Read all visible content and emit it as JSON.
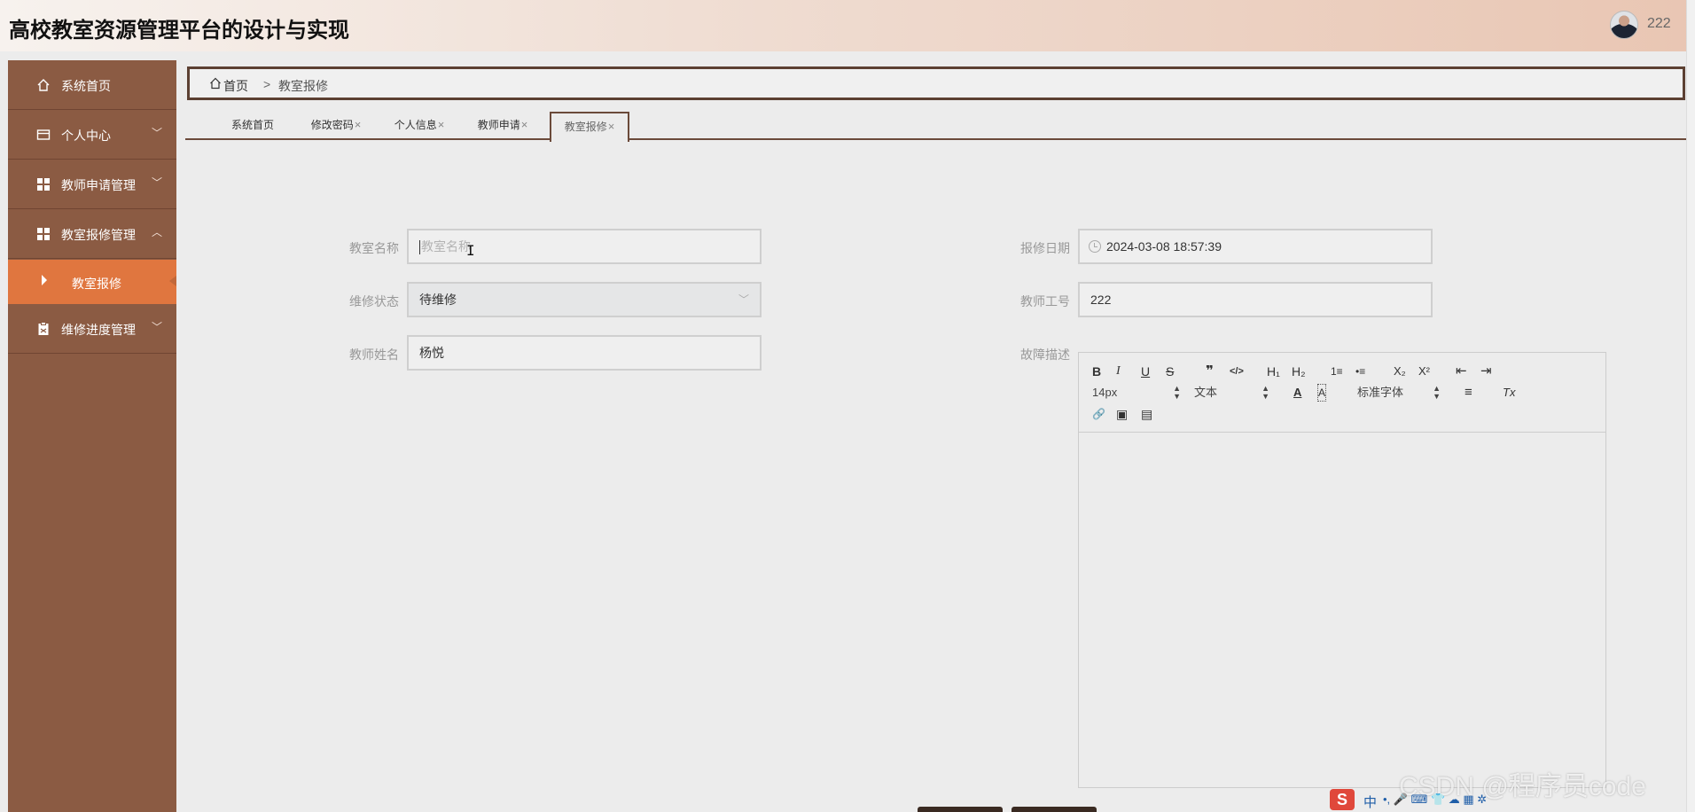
{
  "header": {
    "title": "高校教室资源管理平台的设计与实现",
    "username": "222"
  },
  "sidebar": {
    "items": [
      {
        "label": "系统首页",
        "icon": "home-icon"
      },
      {
        "label": "个人中心",
        "icon": "card-icon",
        "chevron": "﹀"
      },
      {
        "label": "教师申请管理",
        "icon": "grid-icon",
        "chevron": "﹀"
      },
      {
        "label": "教室报修管理",
        "icon": "grid-icon",
        "chevron": "︿"
      },
      {
        "label": "维修进度管理",
        "icon": "clipboard-icon",
        "chevron": "﹀"
      }
    ],
    "active_sub": {
      "label": "教室报修"
    }
  },
  "breadcrumb": {
    "home": "首页",
    "separator": ">",
    "current": "教室报修"
  },
  "tabs": [
    {
      "label": "系统首页",
      "closable": false
    },
    {
      "label": "修改密码",
      "closable": true
    },
    {
      "label": "个人信息",
      "closable": true
    },
    {
      "label": "教师申请",
      "closable": true
    },
    {
      "label": "教室报修",
      "closable": true,
      "active": true
    }
  ],
  "tab_close": "×",
  "form": {
    "classroom_name": {
      "label": "教室名称",
      "value": "",
      "placeholder": "教室名称"
    },
    "repair_status": {
      "label": "维修状态",
      "value": "待维修"
    },
    "teacher_name": {
      "label": "教师姓名",
      "value": "杨悦"
    },
    "repair_date": {
      "label": "报修日期",
      "value": "2024-03-08 18:57:39"
    },
    "teacher_id": {
      "label": "教师工号",
      "value": "222"
    },
    "fault_desc": {
      "label": "故障描述"
    }
  },
  "editor": {
    "font_size": "14px",
    "paragraph": "文本",
    "font_family": "标准字体",
    "buttons": {
      "bold": "B",
      "italic": "I",
      "underline": "U",
      "strike": "S",
      "quote": "❞",
      "code": "</>",
      "h1": "H₁",
      "h2": "H₂",
      "ordered_list": "1≡",
      "bullet_list": "•≡",
      "subscript": "X₂",
      "superscript": "X²",
      "outdent": "⇤",
      "indent": "⇥",
      "font_color": "A",
      "background_color": "A",
      "align": "≡",
      "clean": "Tx",
      "link": "🔗",
      "image": "▣",
      "video": "▤"
    }
  },
  "ime": {
    "brand": "S",
    "mode": "中",
    "items": "•, 🎤 ⌨ 👕 ☁ ▦ ✲"
  },
  "watermark": "CSDN @程序员code",
  "colors": {
    "sidebar": "#8b5b43",
    "active": "#e0763f",
    "border": "#5c4032"
  }
}
